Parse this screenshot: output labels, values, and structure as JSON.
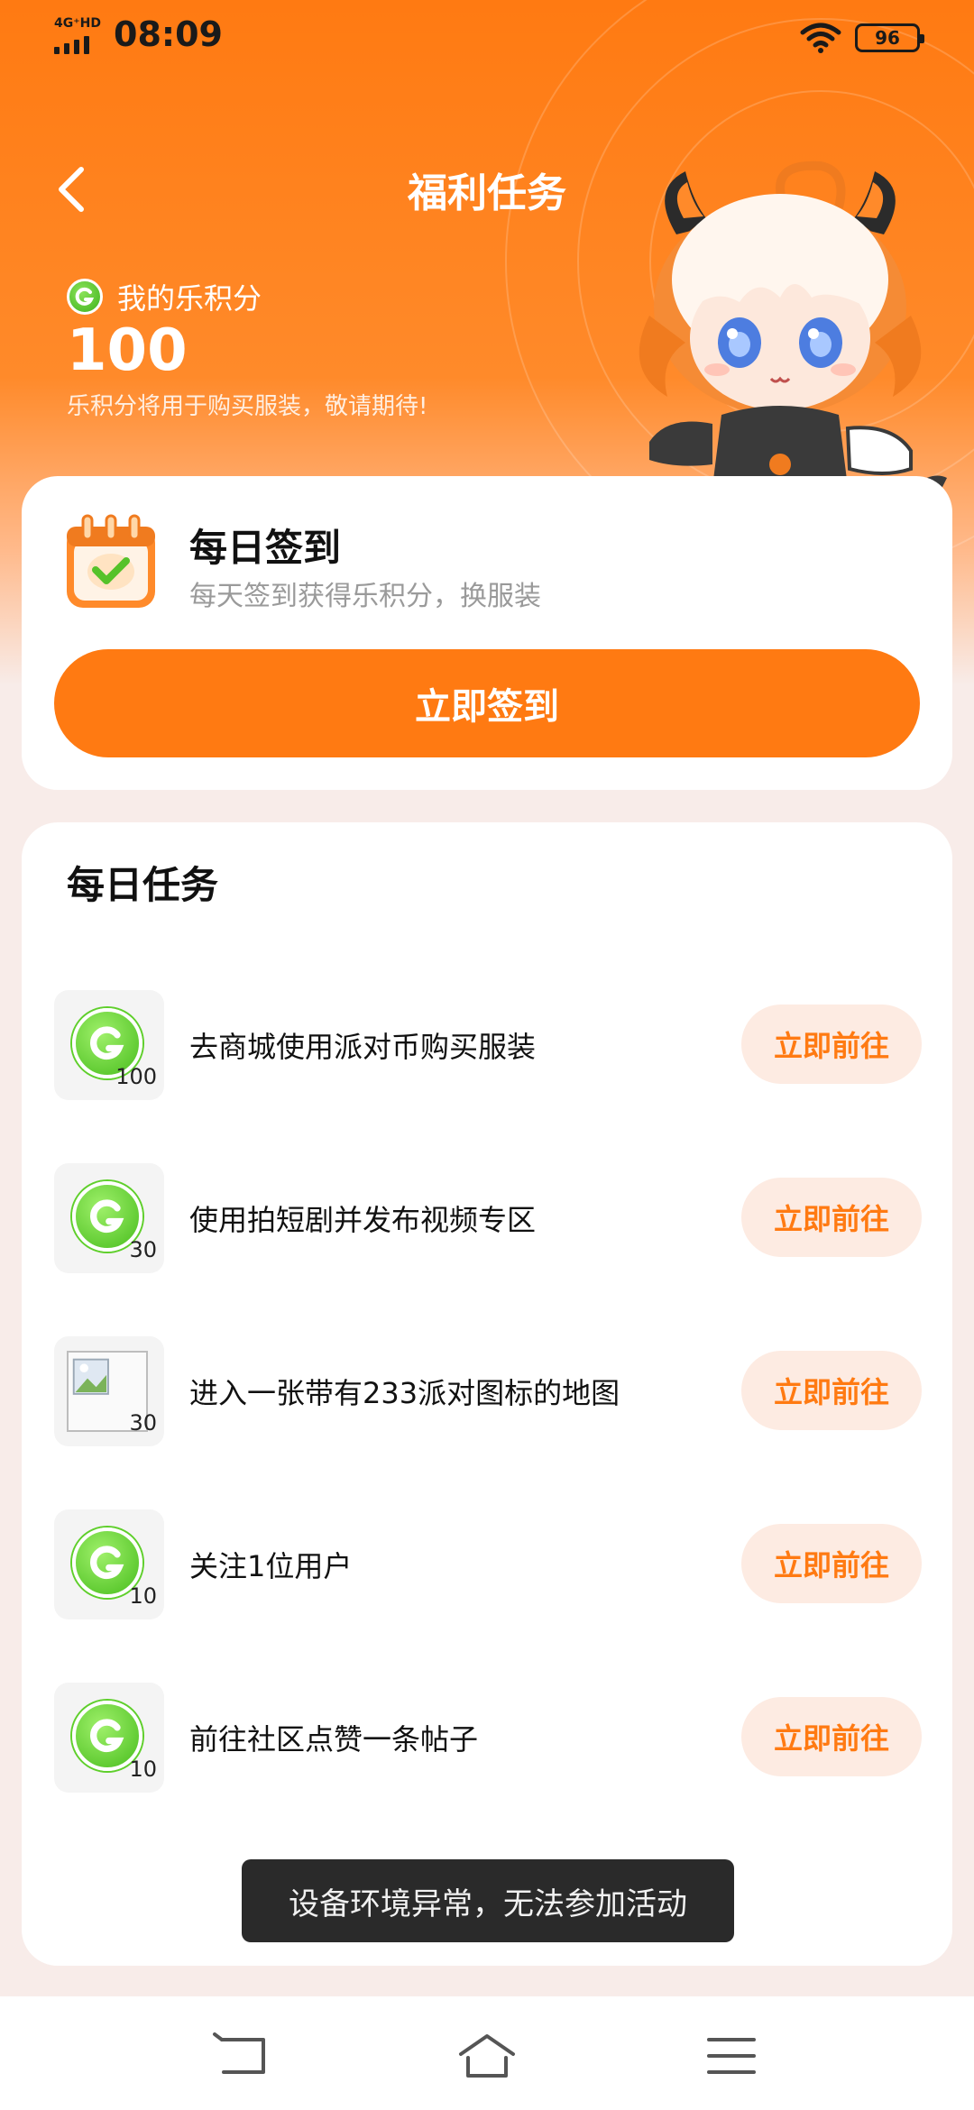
{
  "status_bar": {
    "network": "4G⁺HD",
    "time": "08:09",
    "battery": "96"
  },
  "header": {
    "title": "福利任务"
  },
  "points": {
    "label": "我的乐积分",
    "value": "100",
    "note": "乐积分将用于购买服装，敬请期待!"
  },
  "sign_in": {
    "title": "每日签到",
    "subtitle": "每天签到获得乐积分，换服装",
    "button": "立即签到"
  },
  "daily_tasks": {
    "title": "每日任务",
    "items": [
      {
        "label": "去商城使用派对币购买服装",
        "reward": "100",
        "button": "立即前往",
        "icon": "g-coin-icon"
      },
      {
        "label": "使用拍短剧并发布视频专区",
        "reward": "30",
        "button": "立即前往",
        "icon": "g-coin-icon"
      },
      {
        "label": "进入一张带有233派对图标的地图",
        "reward": "30",
        "button": "立即前往",
        "icon": "broken-image-icon"
      },
      {
        "label": "关注1位用户",
        "reward": "10",
        "button": "立即前往",
        "icon": "g-coin-icon"
      },
      {
        "label": "前往社区点赞一条帖子",
        "reward": "10",
        "button": "立即前往",
        "icon": "g-coin-icon"
      }
    ]
  },
  "toast": {
    "message": "设备环境异常，无法参加活动"
  },
  "colors": {
    "accent": "#ff7a12",
    "coin_green": "#48bd1d",
    "go_button_bg": "#fdebe2"
  }
}
